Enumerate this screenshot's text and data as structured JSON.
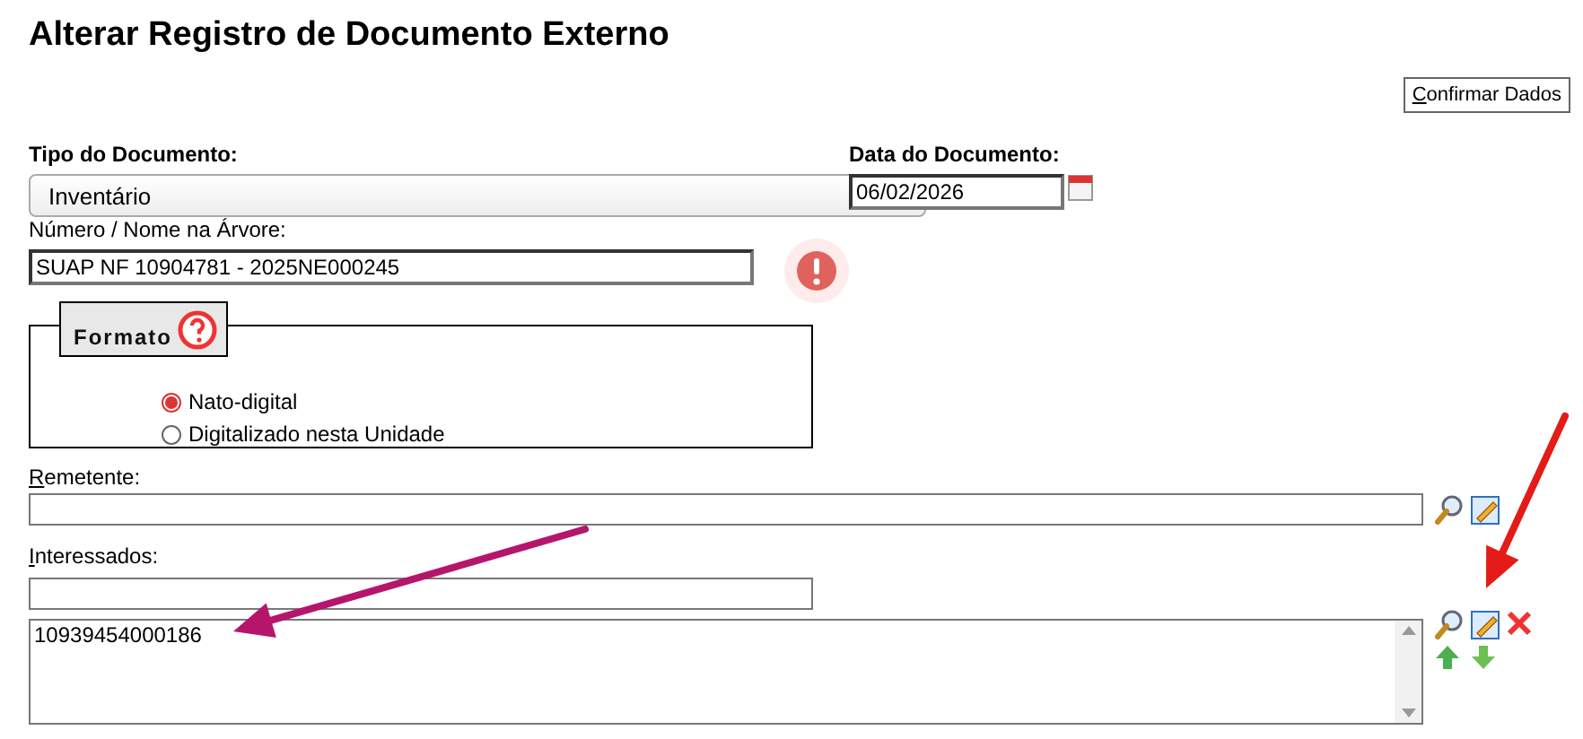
{
  "title": "Alterar Registro de Documento Externo",
  "confirm_button": "Confirmar Dados",
  "tipo": {
    "label": "Tipo do Documento:",
    "value": "Inventário"
  },
  "data": {
    "label": "Data do Documento:",
    "value": "06/02/2026"
  },
  "numero": {
    "label": "Número / Nome na Árvore:",
    "value": "SUAP NF 10904781 - 2025NE000245"
  },
  "formato": {
    "legend": "Formato",
    "options": [
      {
        "label": "Nato-digital",
        "selected": true
      },
      {
        "label": "Digitalizado nesta Unidade",
        "selected": false
      }
    ]
  },
  "remetente": {
    "label": "Remetente:"
  },
  "interessados": {
    "label": "Interessados:",
    "items": [
      "10939454000186"
    ]
  },
  "annotations": [
    {
      "kind": "arrow",
      "color": "#b5166b"
    },
    {
      "kind": "arrow",
      "color": "#e41b17"
    }
  ]
}
